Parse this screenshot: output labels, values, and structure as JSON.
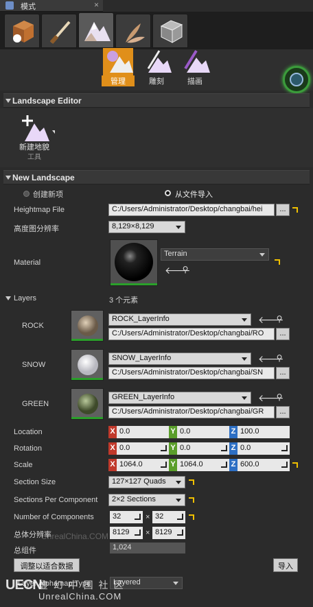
{
  "window": {
    "tab_title": "模式"
  },
  "mode_tabs": [
    {
      "name": "place-mode-tab"
    },
    {
      "name": "paint-mode-tab"
    },
    {
      "name": "landscape-mode-tab",
      "active": true
    },
    {
      "name": "foliage-mode-tab"
    },
    {
      "name": "geometry-mode-tab"
    }
  ],
  "landscape_tools": {
    "manage": "管理",
    "sculpt": "雕刻",
    "paint": "描画"
  },
  "landscape_editor": {
    "header": "Landscape Editor",
    "new_landscape_tool": "新建地貌",
    "tool_sub": "工具"
  },
  "new_landscape": {
    "header": "New Landscape",
    "create_new": "创建新项",
    "import_from_file": "从文件导入",
    "heightmap_file_label": "Heightmap File",
    "heightmap_file_value": "C:/Users/Administrator/Desktop/changbai/hei",
    "browse": "...",
    "heightmap_resolution_label": "高度图分辨率",
    "heightmap_resolution_value": "8,129×8,129",
    "material_label": "Material",
    "material_value": "Terrain",
    "layers_label": "Layers",
    "layers_count": "3 个元素",
    "layers": [
      {
        "name": "ROCK",
        "info": "ROCK_LayerInfo",
        "path": "C:/Users/Administrator/Desktop/changbai/RO"
      },
      {
        "name": "SNOW",
        "info": "SNOW_LayerInfo",
        "path": "C:/Users/Administrator/Desktop/changbai/SN"
      },
      {
        "name": "GREEN",
        "info": "GREEN_LayerInfo",
        "path": "C:/Users/Administrator/Desktop/changbai/GR"
      }
    ],
    "location_label": "Location",
    "location": {
      "x": "0.0",
      "y": "0.0",
      "z": "100.0"
    },
    "rotation_label": "Rotation",
    "rotation": {
      "x": "0.0",
      "y": "0.0",
      "z": "0.0"
    },
    "scale_label": "Scale",
    "scale": {
      "x": "1064.0",
      "y": "1064.0",
      "z": "600.0"
    },
    "axis_x": "X",
    "axis_y": "Y",
    "axis_z": "Z",
    "section_size_label": "Section Size",
    "section_size_value": "127×127 Quads",
    "sections_per_component_label": "Sections Per Component",
    "sections_per_component_value": "2×2 Sections",
    "number_of_components_label": "Number of Components",
    "components_x": "32",
    "components_y": "32",
    "times": "×",
    "overall_resolution_label": "总体分辨率",
    "overall_res_x": "8129",
    "overall_res_y": "8129",
    "total_components_label": "总组件",
    "total_components_value": "1,024",
    "fit_data_button": "调整以适合数据",
    "import_button": "导入",
    "layer_alpha_type_label": "Layer Alphamap Type",
    "layer_alpha_type_value": "Layered"
  },
  "watermark": {
    "brand": "UECN",
    "site": "UnrealChina.COM",
    "cn": "虚 幻 中 国 社 区",
    "mid": "UnrealChina.COM"
  },
  "colors": {
    "accent": "#e08f1a",
    "axis_x": "#c0392b",
    "axis_y": "#5a9e2a",
    "axis_z": "#2d6fc4",
    "reset_arrow": "#f0c000"
  }
}
